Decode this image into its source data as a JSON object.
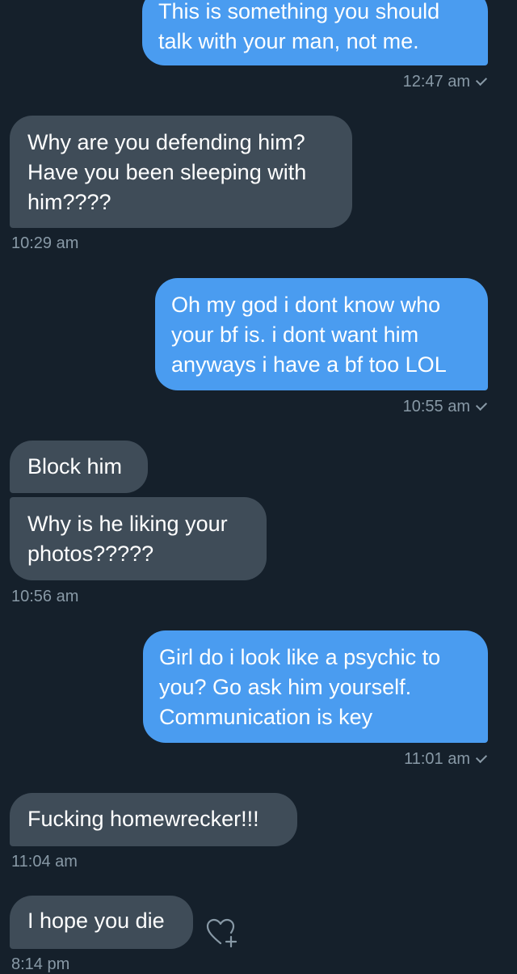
{
  "messages": [
    {
      "direction": "sent",
      "text": "This is something you should\ntalk with your man, not me.",
      "time": "12:47 am",
      "read": true
    },
    {
      "direction": "received",
      "text": "Why are you defending him?\nHave you been sleeping with\nhim????",
      "time": "10:29 am"
    },
    {
      "direction": "sent",
      "text": "Oh my god i dont know who\nyour bf is. i dont want him\nanyways i have a bf too LOL",
      "time": "10:55 am",
      "read": true
    },
    {
      "direction": "received",
      "text": "Block him"
    },
    {
      "direction": "received",
      "text": "Why is he liking your\nphotos?????",
      "time": "10:56 am"
    },
    {
      "direction": "sent",
      "text": "Girl do i look like a psychic to\nyou? Go ask him yourself.\nCommunication is key",
      "time": "11:01 am",
      "read": true
    },
    {
      "direction": "received",
      "text": "Fucking homewrecker!!!",
      "time": "11:04 am"
    },
    {
      "direction": "received",
      "text": "I hope you die",
      "time": "8:14 pm",
      "reaction_button_icon": "heart-plus-icon"
    }
  ],
  "colors": {
    "background": "#15202b",
    "sent_bubble": "#4a9cf0",
    "received_bubble": "#3f4c58",
    "timestamp": "#8899a6"
  }
}
